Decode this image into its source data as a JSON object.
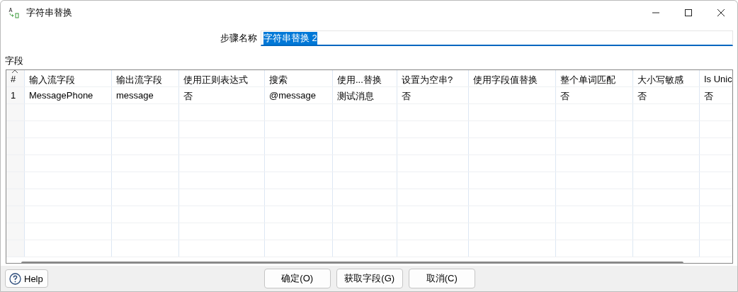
{
  "window": {
    "title": "字符串替换"
  },
  "step_name": {
    "label": "步骤名称",
    "value": "字符串替换 2",
    "text_selected": true
  },
  "fields_label": "字段",
  "table": {
    "columns": [
      {
        "label": "#",
        "sorted": true
      },
      {
        "label": "输入流字段",
        "sorted": false
      },
      {
        "label": "输出流字段",
        "sorted": false
      },
      {
        "label": "使用正则表达式",
        "sorted": false
      },
      {
        "label": "搜索",
        "sorted": false
      },
      {
        "label": "使用...替换",
        "sorted": false
      },
      {
        "label": "设置为空串?",
        "sorted": false
      },
      {
        "label": "使用字段值替换",
        "sorted": false
      },
      {
        "label": "整个单词匹配",
        "sorted": false
      },
      {
        "label": "大小写敏感",
        "sorted": false
      },
      {
        "label": "Is Unic",
        "sorted": false
      }
    ],
    "rows": [
      [
        "1",
        "MessagePhone",
        "message",
        "否",
        "@message",
        "测试消息",
        "否",
        "",
        "否",
        "否",
        "否"
      ]
    ]
  },
  "buttons": {
    "help": "Help",
    "actions": [
      "确定(O)",
      "获取字段(G)",
      "取消(C)"
    ]
  }
}
